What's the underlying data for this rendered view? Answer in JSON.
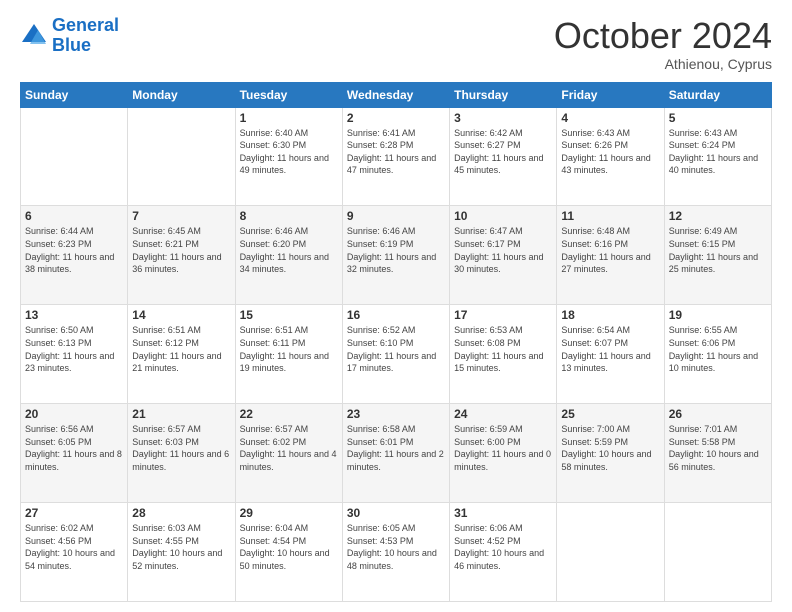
{
  "logo": {
    "line1": "General",
    "line2": "Blue"
  },
  "header": {
    "month": "October 2024",
    "location": "Athienou, Cyprus"
  },
  "weekdays": [
    "Sunday",
    "Monday",
    "Tuesday",
    "Wednesday",
    "Thursday",
    "Friday",
    "Saturday"
  ],
  "weeks": [
    [
      {
        "day": "",
        "sunrise": "",
        "sunset": "",
        "daylight": ""
      },
      {
        "day": "",
        "sunrise": "",
        "sunset": "",
        "daylight": ""
      },
      {
        "day": "1",
        "sunrise": "Sunrise: 6:40 AM",
        "sunset": "Sunset: 6:30 PM",
        "daylight": "Daylight: 11 hours and 49 minutes."
      },
      {
        "day": "2",
        "sunrise": "Sunrise: 6:41 AM",
        "sunset": "Sunset: 6:28 PM",
        "daylight": "Daylight: 11 hours and 47 minutes."
      },
      {
        "day": "3",
        "sunrise": "Sunrise: 6:42 AM",
        "sunset": "Sunset: 6:27 PM",
        "daylight": "Daylight: 11 hours and 45 minutes."
      },
      {
        "day": "4",
        "sunrise": "Sunrise: 6:43 AM",
        "sunset": "Sunset: 6:26 PM",
        "daylight": "Daylight: 11 hours and 43 minutes."
      },
      {
        "day": "5",
        "sunrise": "Sunrise: 6:43 AM",
        "sunset": "Sunset: 6:24 PM",
        "daylight": "Daylight: 11 hours and 40 minutes."
      }
    ],
    [
      {
        "day": "6",
        "sunrise": "Sunrise: 6:44 AM",
        "sunset": "Sunset: 6:23 PM",
        "daylight": "Daylight: 11 hours and 38 minutes."
      },
      {
        "day": "7",
        "sunrise": "Sunrise: 6:45 AM",
        "sunset": "Sunset: 6:21 PM",
        "daylight": "Daylight: 11 hours and 36 minutes."
      },
      {
        "day": "8",
        "sunrise": "Sunrise: 6:46 AM",
        "sunset": "Sunset: 6:20 PM",
        "daylight": "Daylight: 11 hours and 34 minutes."
      },
      {
        "day": "9",
        "sunrise": "Sunrise: 6:46 AM",
        "sunset": "Sunset: 6:19 PM",
        "daylight": "Daylight: 11 hours and 32 minutes."
      },
      {
        "day": "10",
        "sunrise": "Sunrise: 6:47 AM",
        "sunset": "Sunset: 6:17 PM",
        "daylight": "Daylight: 11 hours and 30 minutes."
      },
      {
        "day": "11",
        "sunrise": "Sunrise: 6:48 AM",
        "sunset": "Sunset: 6:16 PM",
        "daylight": "Daylight: 11 hours and 27 minutes."
      },
      {
        "day": "12",
        "sunrise": "Sunrise: 6:49 AM",
        "sunset": "Sunset: 6:15 PM",
        "daylight": "Daylight: 11 hours and 25 minutes."
      }
    ],
    [
      {
        "day": "13",
        "sunrise": "Sunrise: 6:50 AM",
        "sunset": "Sunset: 6:13 PM",
        "daylight": "Daylight: 11 hours and 23 minutes."
      },
      {
        "day": "14",
        "sunrise": "Sunrise: 6:51 AM",
        "sunset": "Sunset: 6:12 PM",
        "daylight": "Daylight: 11 hours and 21 minutes."
      },
      {
        "day": "15",
        "sunrise": "Sunrise: 6:51 AM",
        "sunset": "Sunset: 6:11 PM",
        "daylight": "Daylight: 11 hours and 19 minutes."
      },
      {
        "day": "16",
        "sunrise": "Sunrise: 6:52 AM",
        "sunset": "Sunset: 6:10 PM",
        "daylight": "Daylight: 11 hours and 17 minutes."
      },
      {
        "day": "17",
        "sunrise": "Sunrise: 6:53 AM",
        "sunset": "Sunset: 6:08 PM",
        "daylight": "Daylight: 11 hours and 15 minutes."
      },
      {
        "day": "18",
        "sunrise": "Sunrise: 6:54 AM",
        "sunset": "Sunset: 6:07 PM",
        "daylight": "Daylight: 11 hours and 13 minutes."
      },
      {
        "day": "19",
        "sunrise": "Sunrise: 6:55 AM",
        "sunset": "Sunset: 6:06 PM",
        "daylight": "Daylight: 11 hours and 10 minutes."
      }
    ],
    [
      {
        "day": "20",
        "sunrise": "Sunrise: 6:56 AM",
        "sunset": "Sunset: 6:05 PM",
        "daylight": "Daylight: 11 hours and 8 minutes."
      },
      {
        "day": "21",
        "sunrise": "Sunrise: 6:57 AM",
        "sunset": "Sunset: 6:03 PM",
        "daylight": "Daylight: 11 hours and 6 minutes."
      },
      {
        "day": "22",
        "sunrise": "Sunrise: 6:57 AM",
        "sunset": "Sunset: 6:02 PM",
        "daylight": "Daylight: 11 hours and 4 minutes."
      },
      {
        "day": "23",
        "sunrise": "Sunrise: 6:58 AM",
        "sunset": "Sunset: 6:01 PM",
        "daylight": "Daylight: 11 hours and 2 minutes."
      },
      {
        "day": "24",
        "sunrise": "Sunrise: 6:59 AM",
        "sunset": "Sunset: 6:00 PM",
        "daylight": "Daylight: 11 hours and 0 minutes."
      },
      {
        "day": "25",
        "sunrise": "Sunrise: 7:00 AM",
        "sunset": "Sunset: 5:59 PM",
        "daylight": "Daylight: 10 hours and 58 minutes."
      },
      {
        "day": "26",
        "sunrise": "Sunrise: 7:01 AM",
        "sunset": "Sunset: 5:58 PM",
        "daylight": "Daylight: 10 hours and 56 minutes."
      }
    ],
    [
      {
        "day": "27",
        "sunrise": "Sunrise: 6:02 AM",
        "sunset": "Sunset: 4:56 PM",
        "daylight": "Daylight: 10 hours and 54 minutes."
      },
      {
        "day": "28",
        "sunrise": "Sunrise: 6:03 AM",
        "sunset": "Sunset: 4:55 PM",
        "daylight": "Daylight: 10 hours and 52 minutes."
      },
      {
        "day": "29",
        "sunrise": "Sunrise: 6:04 AM",
        "sunset": "Sunset: 4:54 PM",
        "daylight": "Daylight: 10 hours and 50 minutes."
      },
      {
        "day": "30",
        "sunrise": "Sunrise: 6:05 AM",
        "sunset": "Sunset: 4:53 PM",
        "daylight": "Daylight: 10 hours and 48 minutes."
      },
      {
        "day": "31",
        "sunrise": "Sunrise: 6:06 AM",
        "sunset": "Sunset: 4:52 PM",
        "daylight": "Daylight: 10 hours and 46 minutes."
      },
      {
        "day": "",
        "sunrise": "",
        "sunset": "",
        "daylight": ""
      },
      {
        "day": "",
        "sunrise": "",
        "sunset": "",
        "daylight": ""
      }
    ]
  ]
}
